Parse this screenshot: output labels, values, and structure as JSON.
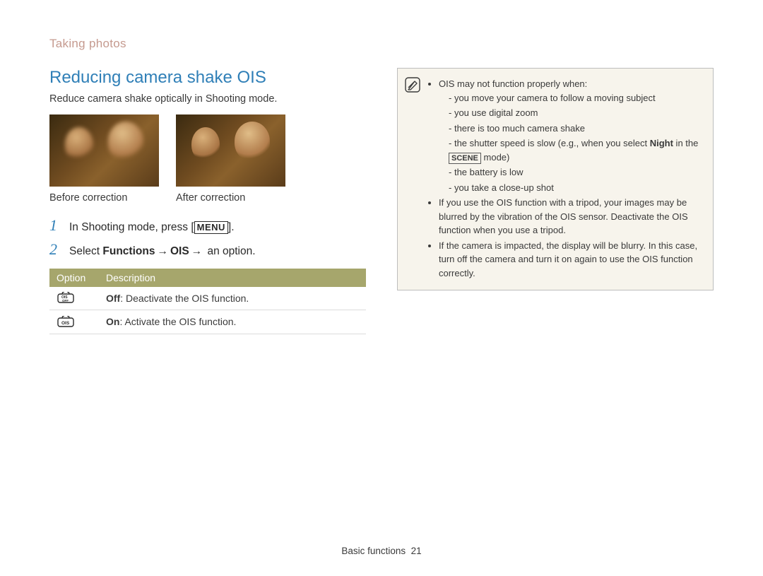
{
  "breadcrumb": "Taking photos",
  "heading": "Reducing camera shake OIS",
  "intro": "Reduce camera shake optically in Shooting mode.",
  "photos": {
    "before_caption": "Before correction",
    "after_caption": "After correction"
  },
  "steps": [
    {
      "num": "1",
      "pre": "In Shooting mode, press [",
      "key": "MENU",
      "post": "]."
    },
    {
      "num": "2",
      "pre": "Select ",
      "b1": "Functions",
      "arrow1": "→",
      "b2": "OIS",
      "arrow2": "→",
      "post": " an option."
    }
  ],
  "table": {
    "headers": {
      "option": "Option",
      "description": "Description"
    },
    "rows": [
      {
        "icon": "ois-off",
        "label": "Off",
        "desc": ": Deactivate the OIS function."
      },
      {
        "icon": "ois-on",
        "label": "On",
        "desc": ": Activate the OIS function."
      }
    ]
  },
  "note": {
    "b0": "OIS may not function properly when:",
    "d0": "you move your camera to follow a moving subject",
    "d1": "you use digital zoom",
    "d2": "there is too much camera shake",
    "d3_pre": "the shutter speed is slow (e.g., when you select ",
    "d3_bold": "Night",
    "d3_mid": " in the ",
    "d3_key": "SCENE",
    "d3_post": " mode)",
    "d4": "the battery is low",
    "d5": "you take a close-up shot",
    "b1": "If you use the OIS function with a tripod, your images may be blurred by the vibration of the OIS sensor. Deactivate the OIS function when you use a tripod.",
    "b2": "If the camera is impacted, the display will be blurry. In this case, turn off the camera and turn it on again to use the OIS function correctly."
  },
  "footer": {
    "label": "Basic functions",
    "page": "21"
  }
}
